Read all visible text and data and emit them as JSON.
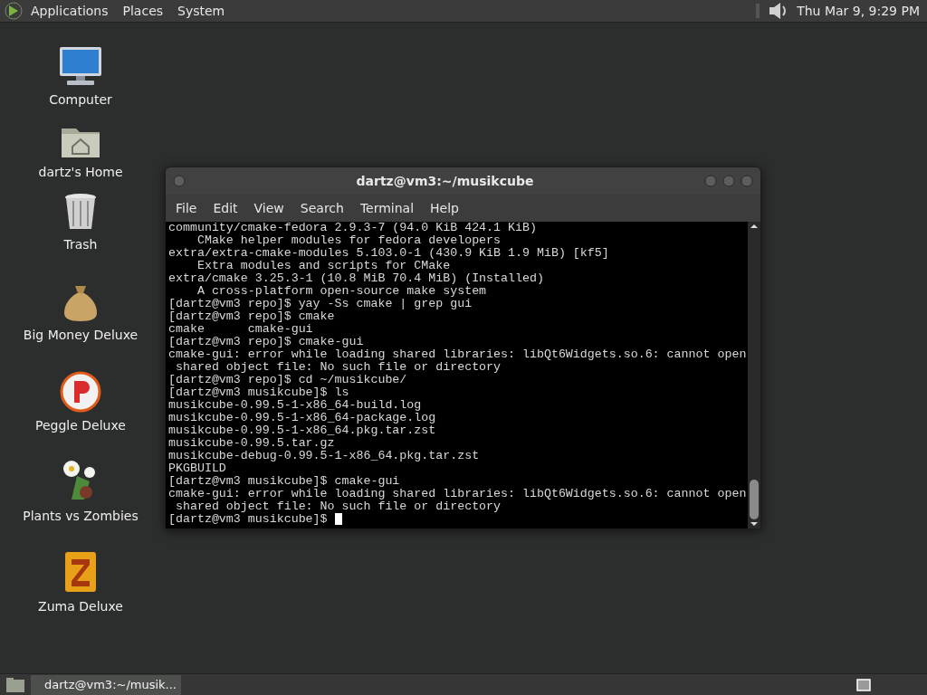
{
  "top_panel": {
    "menus": [
      "Applications",
      "Places",
      "System"
    ],
    "clock": "Thu Mar 9, 9:29 PM"
  },
  "desktop_icons": [
    {
      "kind": "computer",
      "label": "Computer"
    },
    {
      "kind": "home",
      "label": "dartz's Home"
    },
    {
      "kind": "trash",
      "label": "Trash"
    },
    {
      "kind": "money",
      "label": "Big Money Deluxe"
    },
    {
      "kind": "peggle",
      "label": "Peggle Deluxe"
    },
    {
      "kind": "plants",
      "label": "Plants vs Zombies"
    },
    {
      "kind": "zuma",
      "label": "Zuma Deluxe"
    }
  ],
  "terminal": {
    "title": "dartz@vm3:~/musikcube",
    "menu": [
      "File",
      "Edit",
      "View",
      "Search",
      "Terminal",
      "Help"
    ],
    "lines": [
      "community/cmake-fedora 2.9.3-7 (94.0 KiB 424.1 KiB)",
      "    CMake helper modules for fedora developers",
      "extra/extra-cmake-modules 5.103.0-1 (430.9 KiB 1.9 MiB) [kf5]",
      "    Extra modules and scripts for CMake",
      "extra/cmake 3.25.3-1 (10.8 MiB 70.4 MiB) (Installed)",
      "    A cross-platform open-source make system",
      "[dartz@vm3 repo]$ yay -Ss cmake | grep gui",
      "[dartz@vm3 repo]$ cmake",
      "cmake      cmake-gui",
      "[dartz@vm3 repo]$ cmake-gui",
      "cmake-gui: error while loading shared libraries: libQt6Widgets.so.6: cannot open",
      " shared object file: No such file or directory",
      "[dartz@vm3 repo]$ cd ~/musikcube/",
      "[dartz@vm3 musikcube]$ ls",
      "musikcube-0.99.5-1-x86_64-build.log",
      "musikcube-0.99.5-1-x86_64-package.log",
      "musikcube-0.99.5-1-x86_64.pkg.tar.zst",
      "musikcube-0.99.5.tar.gz",
      "musikcube-debug-0.99.5-1-x86_64.pkg.tar.zst",
      "PKGBUILD",
      "[dartz@vm3 musikcube]$ cmake-gui",
      "cmake-gui: error while loading shared libraries: libQt6Widgets.so.6: cannot open",
      " shared object file: No such file or directory",
      "[dartz@vm3 musikcube]$ "
    ]
  },
  "taskbar": {
    "items": [
      {
        "label": "dartz@vm3:~/musik...",
        "selected": true
      }
    ]
  }
}
